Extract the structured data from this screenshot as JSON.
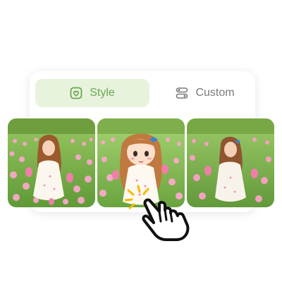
{
  "tabs": [
    {
      "label": "Style",
      "icon": "heart-frame-icon",
      "active": true
    },
    {
      "label": "Custom",
      "icon": "sliders-icon",
      "active": false
    }
  ],
  "images": [
    {
      "name": "original-photo",
      "style": "photo"
    },
    {
      "name": "styled-result-chibi",
      "style": "cartoon"
    },
    {
      "name": "styled-result-photo",
      "style": "photo"
    }
  ],
  "colors": {
    "accent_green": "#6aa84f",
    "active_tab_bg": "#e8f3de",
    "inactive_text": "#7a7a7a",
    "tulip_pink": "#f28db2",
    "sparkle": "#f5b800"
  },
  "cursor": "pointer-hand-icon"
}
